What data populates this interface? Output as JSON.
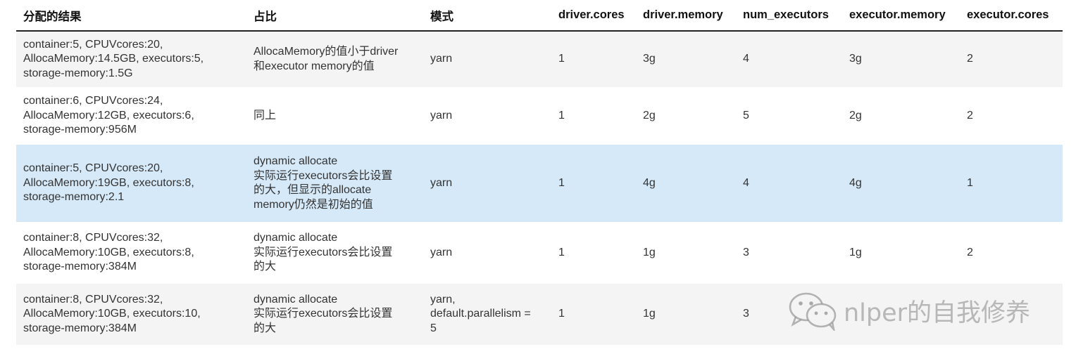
{
  "table": {
    "headers": [
      "分配的结果",
      "占比",
      "模式",
      "driver.cores",
      "driver.memory",
      "num_executors",
      "executor.memory",
      "executor.cores"
    ],
    "rows": [
      {
        "result": "container:5, CPUVcores:20,\nAllocaMemory:14.5GB, executors:5,\nstorage-memory:1.5G",
        "ratio": "AllocaMemory的值小于driver\n和executor memory的值",
        "mode": "yarn",
        "driver_cores": "1",
        "driver_memory": "3g",
        "num_executors": "4",
        "executor_memory": "3g",
        "executor_cores": "2"
      },
      {
        "result": "container:6, CPUVcores:24,\nAllocaMemory:12GB, executors:6,\nstorage-memory:956M",
        "ratio": "同上",
        "mode": "yarn",
        "driver_cores": "1",
        "driver_memory": "2g",
        "num_executors": "5",
        "executor_memory": "2g",
        "executor_cores": "2"
      },
      {
        "result": "container:5, CPUVcores:20,\nAllocaMemory:19GB, executors:8,\nstorage-memory:2.1",
        "ratio": "dynamic allocate\n实际运行executors会比设置\n的大，但显示的allocate\nmemory仍然是初始的值",
        "mode": "yarn",
        "driver_cores": "1",
        "driver_memory": "4g",
        "num_executors": "4",
        "executor_memory": "4g",
        "executor_cores": "1"
      },
      {
        "result": "container:8, CPUVcores:32,\nAllocaMemory:10GB, executors:8,\nstorage-memory:384M",
        "ratio": "dynamic allocate\n实际运行executors会比设置\n的大",
        "mode": "yarn",
        "driver_cores": "1",
        "driver_memory": "1g",
        "num_executors": "3",
        "executor_memory": "1g",
        "executor_cores": "2"
      },
      {
        "result": "container:8, CPUVcores:32,\nAllocaMemory:10GB, executors:10,\nstorage-memory:384M",
        "ratio": "dynamic allocate\n实际运行executors会比设置\n的大",
        "mode": "yarn,\ndefault.parallelism =\n5",
        "driver_cores": "1",
        "driver_memory": "1g",
        "num_executors": "3",
        "executor_memory": "",
        "executor_cores": ""
      }
    ]
  },
  "watermark": {
    "icon": "wechat-icon",
    "text": "nlper的自我修养"
  },
  "colors": {
    "row_alt": "#f4f4f4",
    "row_highlight": "#d6e9f8",
    "header_rule": "#222222"
  }
}
